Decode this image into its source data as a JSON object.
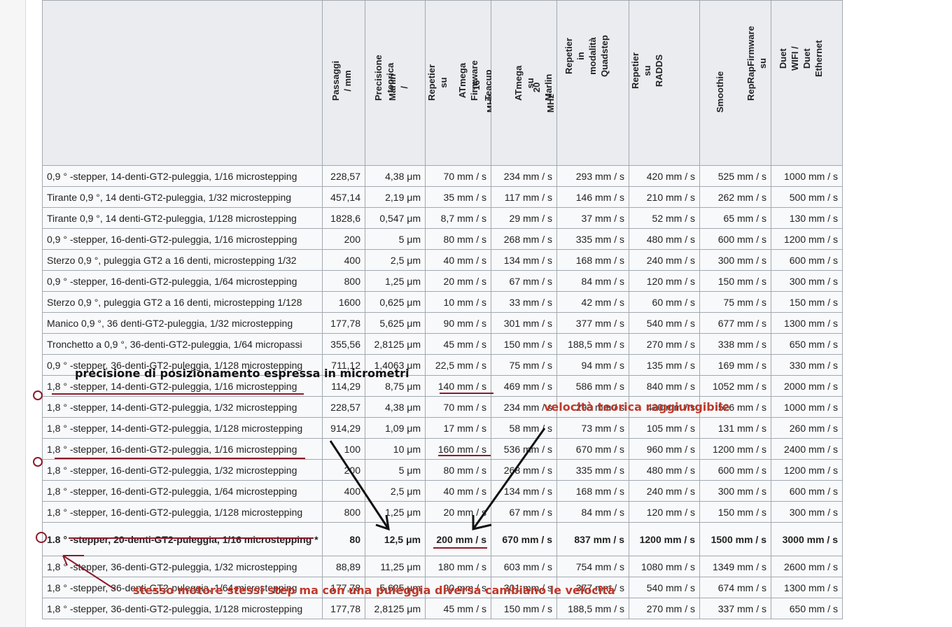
{
  "columns": [
    "",
    "Passaggi\n/ mm",
    "Precisione\nteorica",
    "Marlin\n/",
    "Repetier\nsu",
    "ATmega\nFirmware",
    "16\nTeacup",
    "MHz",
    "ATmega\nsu",
    "20\nMarlin",
    "MHz",
    "Repetier\nin\nmodalità\nQuadstep",
    "Repetier\nsu\nRADDS",
    "Smoothie",
    "RepRapFirmware\nsu",
    "Duet\nWIFI /\nDuet\nEthernet"
  ],
  "rows": [
    [
      "0,9 ° -stepper, 14-denti-GT2-puleggia, 1/16 microstepping",
      "228,57",
      "4,38 μm",
      "70 mm / s",
      "234 mm / s",
      "293 mm / s",
      "420 mm / s",
      "525 mm / s",
      "1000 mm / s"
    ],
    [
      "Tirante 0,9 °, 14 denti-GT2-puleggia, 1/32 microstepping",
      "457,14",
      "2,19 μm",
      "35 mm / s",
      "117 mm / s",
      "146 mm / s",
      "210 mm / s",
      "262 mm / s",
      "500 mm / s"
    ],
    [
      "Tirante 0,9 °, 14 denti-GT2-puleggia, 1/128 microstepping",
      "1828,6",
      "0,547 μm",
      "8,7 mm / s",
      "29 mm / s",
      "37 mm / s",
      "52 mm / s",
      "65 mm / s",
      "130 mm / s"
    ],
    [
      "0,9 ° -stepper, 16-denti-GT2-puleggia, 1/16 microstepping",
      "200",
      "5 μm",
      "80 mm / s",
      "268 mm / s",
      "335 mm / s",
      "480 mm / s",
      "600 mm / s",
      "1200 mm / s"
    ],
    [
      "Sterzo 0,9 °, puleggia GT2 a 16 denti, microstepping 1/32",
      "400",
      "2,5 μm",
      "40 mm / s",
      "134 mm / s",
      "168 mm / s",
      "240 mm / s",
      "300 mm / s",
      "600 mm / s"
    ],
    [
      "0,9 ° -stepper, 16-denti-GT2-puleggia, 1/64 microstepping",
      "800",
      "1,25 μm",
      "20 mm / s",
      "67 mm / s",
      "84 mm / s",
      "120 mm / s",
      "150 mm / s",
      "300 mm / s"
    ],
    [
      "Sterzo 0,9 °, puleggia GT2 a 16 denti, microstepping 1/128",
      "1600",
      "0,625 μm",
      "10 mm / s",
      "33 mm / s",
      "42 mm / s",
      "60 mm / s",
      "75 mm / s",
      "150 mm / s"
    ],
    [
      "Manico 0,9 °, 36 denti-GT2-puleggia, 1/32 microstepping",
      "177,78",
      "5,625 μm",
      "90 mm / s",
      "301 mm / s",
      "377 mm / s",
      "540 mm / s",
      "677 mm / s",
      "1300 mm / s"
    ],
    [
      "Tronchetto a 0,9 °, 36-denti-GT2-puleggia, 1/64 micropassi",
      "355,56",
      "2,8125 μm",
      "45 mm / s",
      "150 mm / s",
      "188,5 mm / s",
      "270 mm / s",
      "338 mm / s",
      "650 mm / s"
    ],
    [
      "0,9 ° -stepper, 36-denti-GT2-puleggia, 1/128 microstepping",
      "711,12",
      "1,4063 μm",
      "22,5 mm / s",
      "75 mm / s",
      "94 mm / s",
      "135 mm / s",
      "169 mm / s",
      "330 mm / s"
    ],
    [
      "1,8 ° -stepper, 14-denti-GT2-puleggia, 1/16 microstepping",
      "114,29",
      "8,75 μm",
      "140 mm / s",
      "469 mm / s",
      "586 mm / s",
      "840 mm / s",
      "1052 mm / s",
      "2000 mm / s"
    ],
    [
      "1,8 ° -stepper, 14-denti-GT2-puleggia, 1/32 microstepping",
      "228,57",
      "4,38 μm",
      "70 mm / s",
      "234 mm / s",
      "293 mm / s",
      "420 mm / s",
      "526 mm / s",
      "1000 mm / s"
    ],
    [
      "1,8 ° -stepper, 14-denti-GT2-puleggia, 1/128 microstepping",
      "914,29",
      "1,09 μm",
      "17 mm / s",
      "58 mm / s",
      "73 mm / s",
      "105 mm / s",
      "131 mm / s",
      "260 mm / s"
    ],
    [
      "1,8 ° -stepper, 16-denti-GT2-puleggia, 1/16 microstepping",
      "100",
      "10 μm",
      "160 mm / s",
      "536 mm / s",
      "670 mm / s",
      "960 mm / s",
      "1200 mm / s",
      "2400 mm / s"
    ],
    [
      "1,8 ° -stepper, 16-denti-GT2-puleggia, 1/32 microstepping",
      "200",
      "5 μm",
      "80 mm / s",
      "268 mm / s",
      "335 mm / s",
      "480 mm / s",
      "600 mm / s",
      "1200 mm / s"
    ],
    [
      "1,8 ° -stepper, 16-denti-GT2-puleggia, 1/64 microstepping",
      "400",
      "2,5 μm",
      "40 mm / s",
      "134 mm / s",
      "168 mm / s",
      "240 mm / s",
      "300 mm / s",
      "600 mm / s"
    ],
    [
      "1,8 ° -stepper, 16-denti-GT2-puleggia, 1/128 microstepping",
      "800",
      "1,25 μm",
      "20 mm / s",
      "67 mm / s",
      "84 mm / s",
      "120 mm / s",
      "150 mm / s",
      "300 mm / s"
    ],
    [
      "1.8 ° -stepper, 20-denti-GT2-puleggia, 1/16 microstepping *",
      "80",
      "12,5 μm",
      "200 mm / s",
      "670 mm / s",
      "837 mm / s",
      "1200 mm / s",
      "1500 mm / s",
      "3000 mm / s"
    ],
    [
      "1,8 ° -stepper, 36-denti-GT2-puleggia, 1/32 microstepping",
      "88,89",
      "11,25 μm",
      "180 mm / s",
      "603 mm / s",
      "754 mm / s",
      "1080 mm / s",
      "1349 mm / s",
      "2600 mm / s"
    ],
    [
      "1,8 ° -stepper, 36-denti-GT2-puleggia, 1/64 microstepping",
      "177,78",
      "5,625 μm",
      "90 mm / s",
      "301 mm / s",
      "377 mm / s",
      "540 mm / s",
      "674 mm / s",
      "1300 mm / s"
    ],
    [
      "1,8 ° -stepper, 36-denti-GT2-puleggia, 1/128 microstepping",
      "177,78",
      "2,8125 μm",
      "45 mm / s",
      "150 mm / s",
      "188,5 mm / s",
      "270 mm / s",
      "337 mm / s",
      "650 mm / s"
    ]
  ],
  "annotations": {
    "precision_note": "precisione di posizionamento espressa in micrometri",
    "speed_note": "velocità teorica raggiungibile",
    "same_motor_note": "stesso motore stessi step  ma con una puleggia diversa cambiano le velocità"
  }
}
